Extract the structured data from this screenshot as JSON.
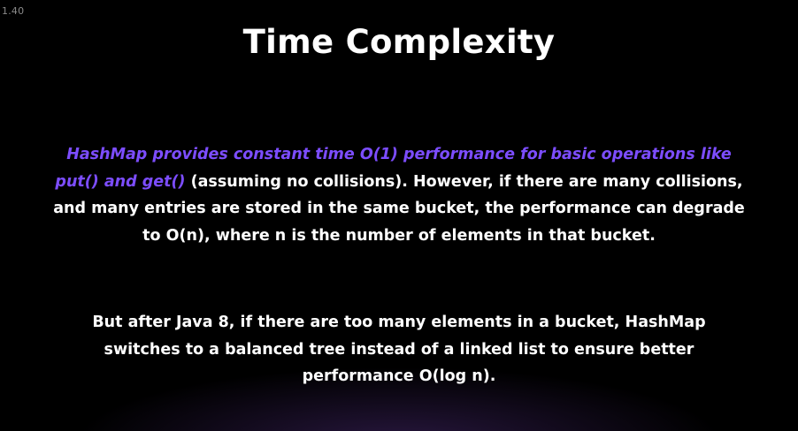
{
  "corner_label": "1.40",
  "slide": {
    "title": "Time Complexity",
    "paragraph1": {
      "highlight": "HashMap provides constant time O(1) performance for basic operations like put() and get()",
      "rest": " (assuming no collisions). However, if there are many collisions, and many entries are stored in the same bucket, the performance can degrade to O(n), where n is the number of elements in that bucket."
    },
    "paragraph2": "But after Java 8, if there are too many elements in a bucket, HashMap switches to a balanced tree instead of a linked list to ensure better performance O(log n)."
  },
  "colors": {
    "background": "#000000",
    "text": "#ffffff",
    "highlight": "#7c4dff"
  }
}
